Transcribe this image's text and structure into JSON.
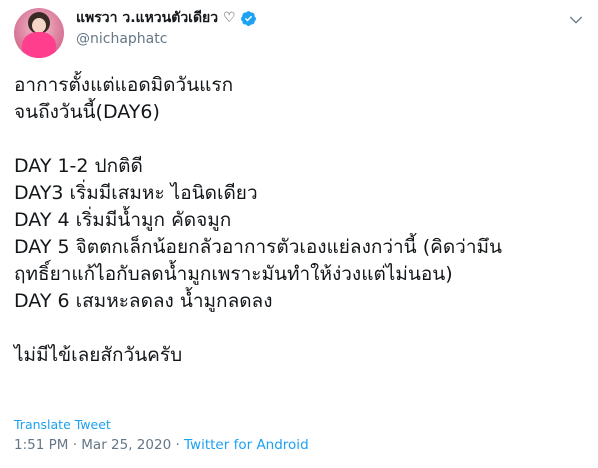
{
  "author": {
    "display_name": "แพรวา ว.แหวนตัวเดียว ♡",
    "handle": "@nichaphatc",
    "verified": true
  },
  "icons": {
    "verified": "verified-badge-icon",
    "more": "chevron-down-icon"
  },
  "colors": {
    "link": "#1da1f2",
    "verified": "#1da1f2",
    "muted": "#657786",
    "text": "#14171a"
  },
  "tweet": {
    "lines": [
      "อาการตั้งแต่แอดมิดวันแรก",
      "จนถึงวันนี้(DAY6)",
      "",
      "DAY 1-2 ปกติดี",
      "DAY3 เริ่มมีเสมหะ ไอนิดเดียว",
      "DAY 4 เริ่มมีน้ำมูก คัดจมูก",
      "DAY 5 จิตตกเล็กน้อยกลัวอาการตัวเองแย่ลงกว่านี้ (คิดว่ามึน",
      "ฤทธิ์ยาแก้ไอกับลดน้ำมูกเพราะมันทำให้ง่วงแต่ไม่นอน)",
      "DAY 6 เสมหะลดลง น้ำมูกลดลง",
      "",
      "ไม่มีไข้เลยสักวันครับ"
    ],
    "translate_label": "Translate Tweet",
    "time": "1:51 PM",
    "separator": " · ",
    "date": "Mar 25, 2020",
    "source": "Twitter for Android"
  }
}
